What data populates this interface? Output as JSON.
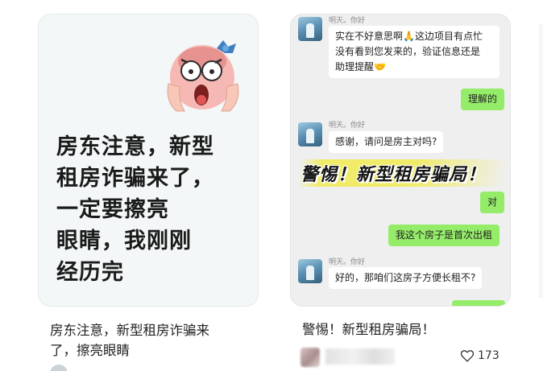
{
  "card1": {
    "headline_lines": [
      "房东注意，新型",
      "租房诈骗来了，",
      "一定要擦亮",
      "眼睛，我刚刚",
      "经历完"
    ],
    "title_lines": [
      "房东注意，新型租房诈骗来",
      "了，擦亮眼睛"
    ],
    "emoji_icon": "screaming-face-icon"
  },
  "card2": {
    "chat": {
      "sender_name": "明天。你好",
      "msg1": [
        "实在不好意思啊🙏这边项目有点忙",
        "没有看到您发来的，验证信息还是",
        "助理提醒🤝"
      ],
      "reply1": "理解的",
      "msg2": "感谢，请问是房主对吗?",
      "banner": "警惕！新型租房骗局！",
      "reply2": "对",
      "reply3": "我这个房子是首次出租",
      "msg3": "好的，那咱们这房子方便长租不?"
    },
    "title": "警惕！新型租房骗局！",
    "likes": "173",
    "like_icon": "heart-icon"
  },
  "colors": {
    "outgoing_bubble": "#95ec69",
    "banner_highlight": "#f0eb5a"
  }
}
